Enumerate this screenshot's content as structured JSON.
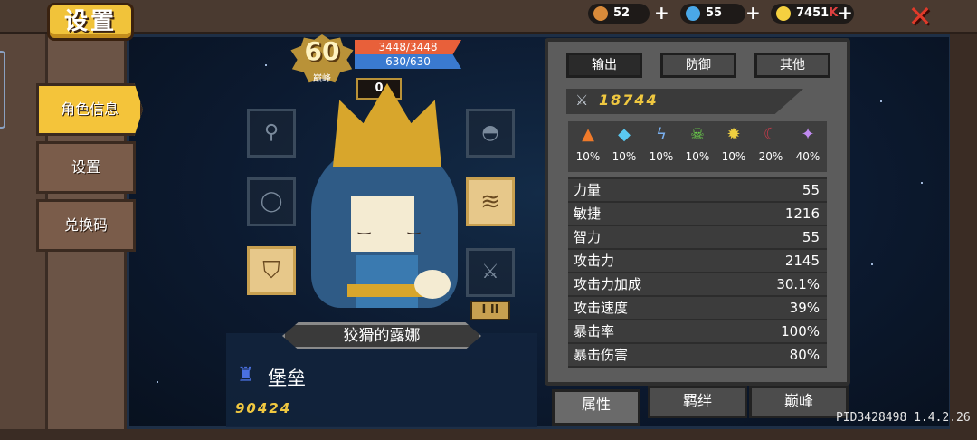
{
  "title": "设置",
  "side_menu": [
    {
      "label": "角色信息",
      "active": true
    },
    {
      "label": "设置",
      "active": false
    },
    {
      "label": "兑换码",
      "active": false
    }
  ],
  "currencies": [
    {
      "icon": "material-icon",
      "value": "52",
      "color": "#d88a3a"
    },
    {
      "icon": "gem-icon",
      "value": "55",
      "color": "#4aa8e8"
    },
    {
      "icon": "gold-coin-icon",
      "value": "7451",
      "suffix": "K",
      "color": "#f4d040"
    }
  ],
  "plus_symbol": "+",
  "close_symbol": "✕",
  "level": {
    "value": "60",
    "tag": "巅峰"
  },
  "hp": "3448/3448",
  "mp": "630/630",
  "counter": "0",
  "hero_name": "狡猾的露娜",
  "class_name": "堡垒",
  "class_icon": "fortress-icon",
  "power": "90424",
  "rank_badge": "I II",
  "slots": [
    {
      "name": "slot-staff",
      "glyph": "⚲",
      "filled": false
    },
    {
      "name": "slot-helmet",
      "glyph": "◓",
      "filled": false
    },
    {
      "name": "slot-ring",
      "glyph": "◯",
      "filled": false
    },
    {
      "name": "slot-armor",
      "glyph": "≋",
      "filled": true
    },
    {
      "name": "slot-boots",
      "glyph": "⛉",
      "filled": true
    },
    {
      "name": "slot-sword",
      "glyph": "⚔",
      "filled": false
    }
  ],
  "stat_tabs": [
    "输出",
    "防御",
    "其他"
  ],
  "attack_value": "18744",
  "elements": [
    {
      "icon": "fire-icon",
      "glyph": "🔥",
      "color": "#f07a2a",
      "value": "10%"
    },
    {
      "icon": "ice-icon",
      "glyph": "◆",
      "color": "#5ac8f0",
      "value": "10%"
    },
    {
      "icon": "lightning-icon",
      "glyph": "ϟ",
      "color": "#7ab0f0",
      "value": "10%"
    },
    {
      "icon": "poison-skull-icon",
      "glyph": "☠",
      "color": "#6ad04a",
      "value": "10%"
    },
    {
      "icon": "light-icon",
      "glyph": "✹",
      "color": "#f0d040",
      "value": "10%"
    },
    {
      "icon": "dark-icon",
      "glyph": "☾",
      "color": "#c83a4a",
      "value": "20%"
    },
    {
      "icon": "arcane-icon",
      "glyph": "✦",
      "color": "#c08af0",
      "value": "40%"
    }
  ],
  "stats": [
    {
      "label": "力量",
      "value": "55"
    },
    {
      "label": "敏捷",
      "value": "1216"
    },
    {
      "label": "智力",
      "value": "55"
    },
    {
      "label": "攻击力",
      "value": "2145"
    },
    {
      "label": "攻击力加成",
      "value": "30.1%"
    },
    {
      "label": "攻击速度",
      "value": "39%"
    },
    {
      "label": "暴击率",
      "value": "100%"
    },
    {
      "label": "暴击伤害",
      "value": "80%"
    }
  ],
  "bottom_tabs": [
    {
      "label": "属性",
      "selected": true
    },
    {
      "label": "羁绊",
      "selected": false
    },
    {
      "label": "巅峰",
      "selected": false
    }
  ],
  "pid": "PID3428498 1.4.2.26"
}
